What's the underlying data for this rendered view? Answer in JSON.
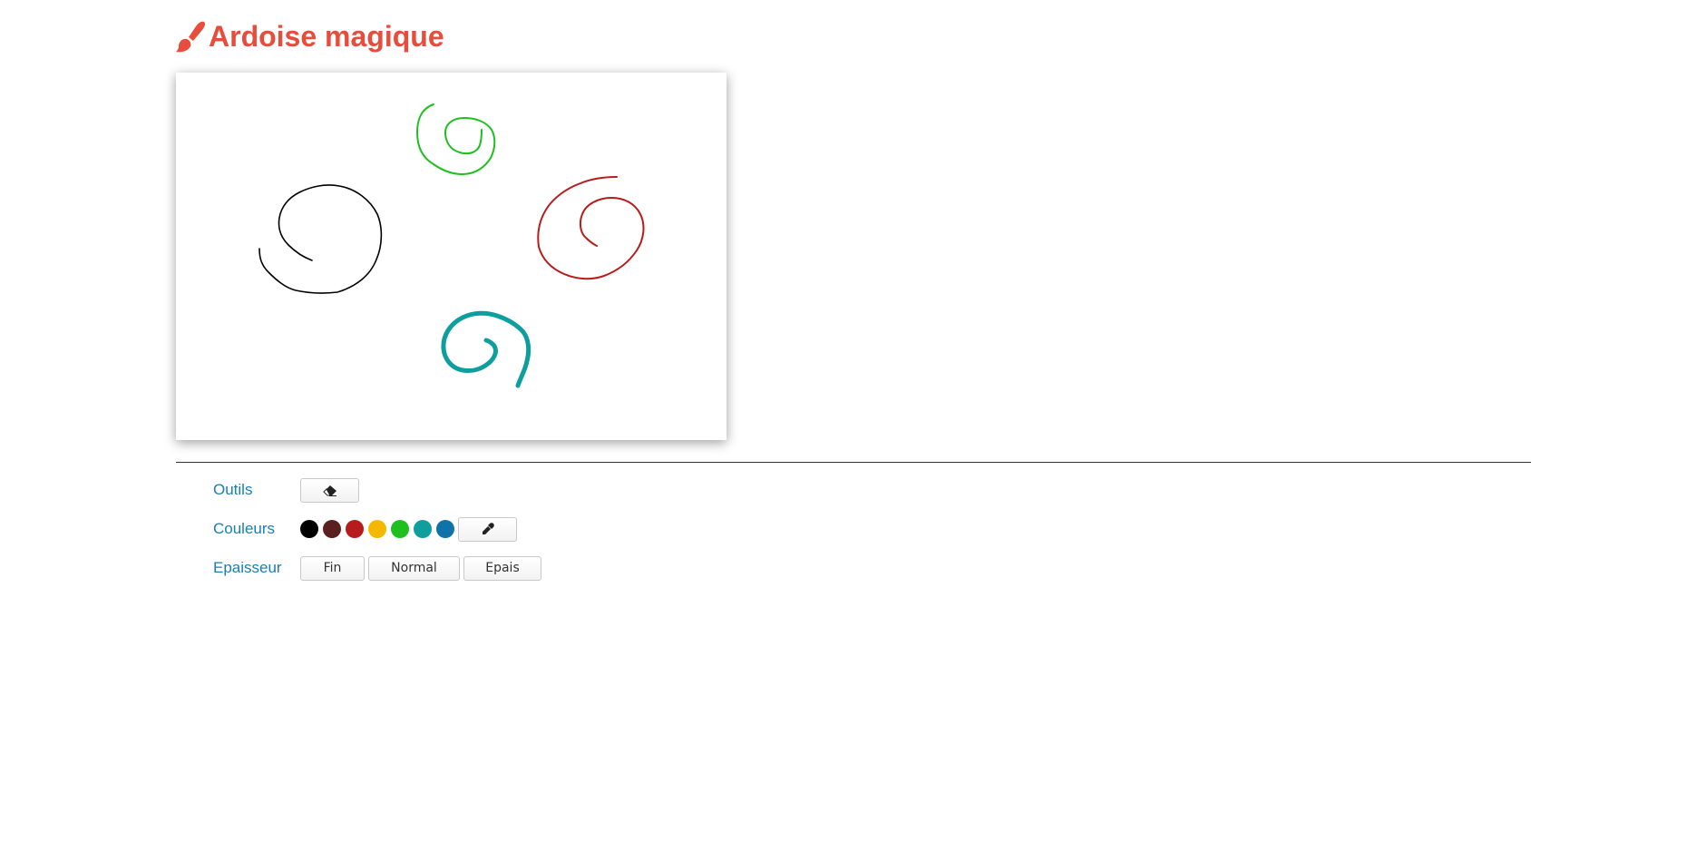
{
  "app": {
    "title": "Ardoise magique",
    "title_color": "#e74c3c",
    "title_icon": "paint-brush-icon"
  },
  "canvas": {
    "background": "#ffffff",
    "strokes": [
      {
        "name": "green-spiral",
        "color": "#1fbf1f",
        "width": 2
      },
      {
        "name": "black-spiral",
        "color": "#000000",
        "width": 1.6
      },
      {
        "name": "red-spiral",
        "color": "#b71c1c",
        "width": 2
      },
      {
        "name": "teal-spiral",
        "color": "#0f9e9e",
        "width": 5
      }
    ]
  },
  "tools": {
    "outils_label": "Outils",
    "eraser_icon": "eraser-icon",
    "couleurs_label": "Couleurs",
    "colors": [
      {
        "name": "black",
        "hex": "#000000"
      },
      {
        "name": "dark-brown",
        "hex": "#5a1f1f"
      },
      {
        "name": "red",
        "hex": "#b71c1c"
      },
      {
        "name": "yellow",
        "hex": "#f5b800"
      },
      {
        "name": "green",
        "hex": "#1fbf1f"
      },
      {
        "name": "teal",
        "hex": "#0f9e9e"
      },
      {
        "name": "blue",
        "hex": "#0f72a8"
      }
    ],
    "color_picker_icon": "eyedropper-icon",
    "epaisseur_label": "Epaisseur",
    "thickness": {
      "fin": "Fin",
      "normal": "Normal",
      "epais": "Epais"
    }
  },
  "colors": {
    "label": "#1a7fb0",
    "divider": "#333333"
  }
}
